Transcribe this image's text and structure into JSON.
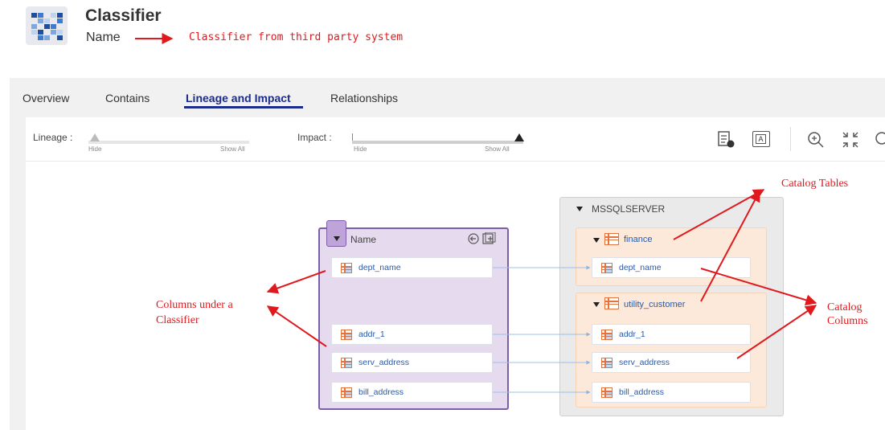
{
  "header": {
    "title": "Classifier",
    "subtitle": "Name",
    "note": "Classifier from third party system"
  },
  "tabs": [
    {
      "label": "Overview",
      "active": false
    },
    {
      "label": "Contains",
      "active": false
    },
    {
      "label": "Lineage and Impact",
      "active": true
    },
    {
      "label": "Relationships",
      "active": false
    }
  ],
  "controls": {
    "lineage": {
      "label": "Lineage :",
      "min_label": "Hide",
      "max_label": "Show All",
      "level": 0
    },
    "impact": {
      "label": "Impact :",
      "min_label": "Hide",
      "max_label": "Show All",
      "level": 1
    },
    "toolbar_icons": [
      "table-export-icon",
      "text-format-icon",
      "zoom-in-icon",
      "fit-to-screen-icon",
      "zoom-out-icon"
    ],
    "format_icon_text": "A"
  },
  "classifier_node": {
    "title": "Name",
    "columns": [
      "dept_name",
      "addr_1",
      "serv_address",
      "bill_address"
    ]
  },
  "server_node": {
    "title": "MSSQLSERVER",
    "tables": [
      {
        "name": "finance",
        "columns": [
          "dept_name"
        ]
      },
      {
        "name": "utility_customer",
        "columns": [
          "addr_1",
          "serv_address",
          "bill_address"
        ]
      }
    ]
  },
  "annotations": {
    "catalog_tables": "Catalog Tables",
    "catalog_columns_line1": "Catalog",
    "catalog_columns_line2": "Columns",
    "classifier_columns_line1": "Columns under a",
    "classifier_columns_line2": "Classifier"
  },
  "colors": {
    "annotation_red": "#e0191d",
    "tab_active": "#1b2c8a",
    "classifier_fill": "#e6daee",
    "classifier_border": "#7f5ea8",
    "table_fill": "#fde9d9",
    "column_text": "#2a5aa8",
    "table_icon": "#e8733a"
  }
}
